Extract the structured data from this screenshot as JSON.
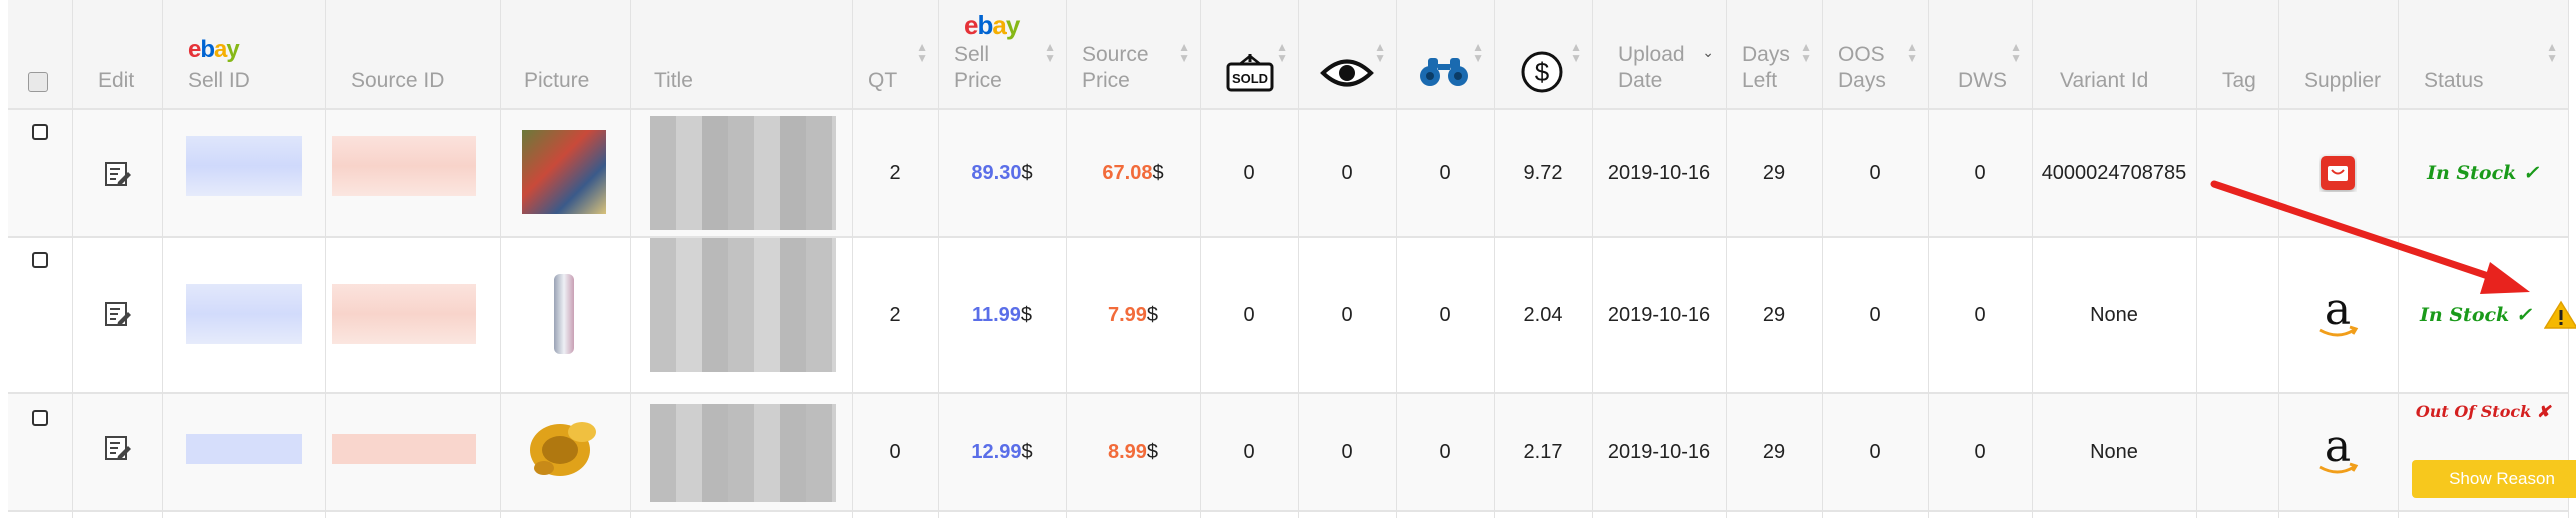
{
  "header": {
    "edit": "Edit",
    "ebay_logo": [
      "e",
      "b",
      "a",
      "y"
    ],
    "sell_id": "Sell ID",
    "source_id": "Source ID",
    "picture": "Picture",
    "title": "Title",
    "qt": "QT",
    "sell_price_1": "Sell",
    "sell_price_2": "Price",
    "source_price_1": "Source",
    "source_price_2": "Price",
    "sold_icon_text": "SOLD",
    "upload_date_1": "Upload",
    "upload_date_2": "Date",
    "days_left_1": "Days",
    "days_left_2": "Left",
    "oos_days_1": "OOS",
    "oos_days_2": "Days",
    "dws": "DWS",
    "variant_id": "Variant Id",
    "tag": "Tag",
    "supplier": "Supplier",
    "status": "Status"
  },
  "rows": [
    {
      "qt": "2",
      "sell_price": "89.30",
      "source_price": "67.08",
      "currency": "$",
      "sold": "0",
      "watchers": "0",
      "views": "0",
      "profit": "9.72",
      "upload_date": "2019-10-16",
      "days_left": "29",
      "oos_days": "0",
      "dws": "0",
      "variant_id": "4000024708785",
      "supplier": "aliexpress",
      "status": "In Stock ✓"
    },
    {
      "qt": "2",
      "sell_price": "11.99",
      "source_price": "7.99",
      "currency": "$",
      "sold": "0",
      "watchers": "0",
      "views": "0",
      "profit": "2.04",
      "upload_date": "2019-10-16",
      "days_left": "29",
      "oos_days": "0",
      "dws": "0",
      "variant_id": "None",
      "supplier": "amazon",
      "status": "In Stock ✓"
    },
    {
      "qt": "0",
      "sell_price": "12.99",
      "source_price": "8.99",
      "currency": "$",
      "sold": "0",
      "watchers": "0",
      "views": "0",
      "profit": "2.17",
      "upload_date": "2019-10-16",
      "days_left": "29",
      "oos_days": "0",
      "dws": "0",
      "variant_id": "None",
      "supplier": "amazon",
      "status": "Out Of Stock ✘",
      "show_reason": "Show Reason"
    }
  ],
  "colors": {
    "sell_price": "#5a6ee8",
    "source_price": "#f26b3a",
    "in_stock": "#1a9a1a",
    "out_of_stock": "#d42020",
    "show_reason_bg": "#f7c81d",
    "arrow": "#e8231e",
    "warning": "#f5b800"
  }
}
